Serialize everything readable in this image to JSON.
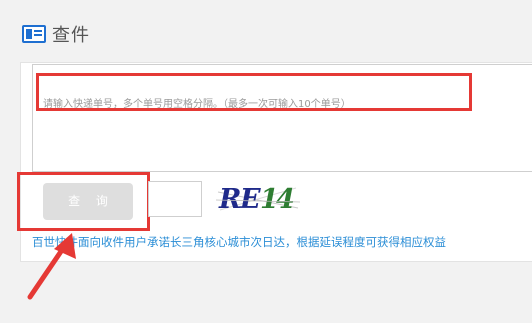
{
  "header": {
    "title": "查件",
    "icon": "document-icon"
  },
  "tracking_input": {
    "placeholder": "请输入快递单号，多个单号用空格分隔。（最多一次可输入10个单号）",
    "value": ""
  },
  "query_button": {
    "label": "查 询"
  },
  "captcha": {
    "input_value": "",
    "image_text": "RE14"
  },
  "notice": {
    "text": "百世快件面向收件用户承诺长三角核心城市次日达，根据延误程度可获得相应权益"
  },
  "colors": {
    "accent": "#1e6fd1",
    "highlight": "#e53935",
    "link": "#2b8ed6",
    "button_disabled": "#dedede"
  }
}
